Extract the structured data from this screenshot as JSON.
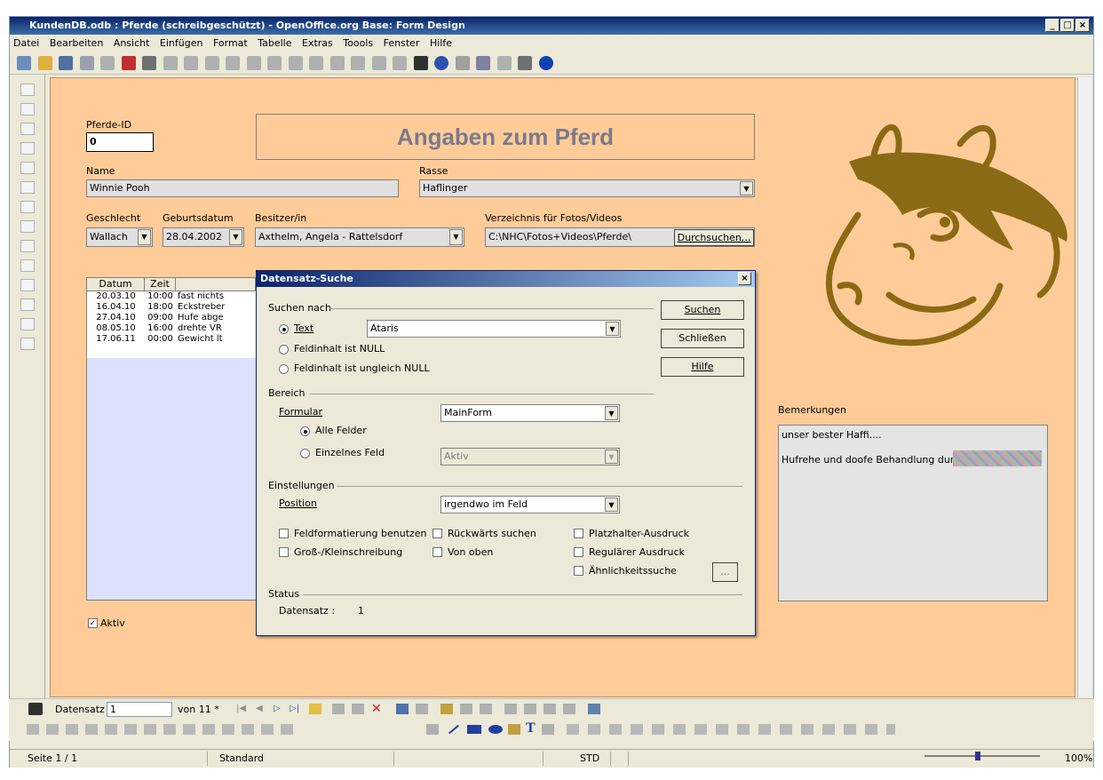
{
  "window": {
    "title": "KundenDB.odb : Pferde (schreibgeschützt) - OpenOffice.org Base: Form Design",
    "menu": [
      "Datei",
      "Bearbeiten",
      "Ansicht",
      "Einfügen",
      "Format",
      "Tabelle",
      "Extras",
      "Toools",
      "Fenster",
      "Hilfe"
    ]
  },
  "form": {
    "title": "Angaben zum Pferd",
    "pferde_id_label": "Pferde-ID",
    "pferde_id_value": "0",
    "name_label": "Name",
    "name_value": "Winnie Pooh",
    "rasse_label": "Rasse",
    "rasse_value": "Haflinger",
    "geschlecht_label": "Geschlecht",
    "geschlecht_value": "Wallach",
    "geburtsdatum_label": "Geburtsdatum",
    "geburtsdatum_value": "28.04.2002",
    "besitzer_label": "Besitzer/in",
    "besitzer_value": "Axthelm, Angela - Rattelsdorf",
    "verzeichnis_label": "Verzeichnis für Fotos/Videos",
    "verzeichnis_value": "C:\\NHC\\Fotos+Videos\\Pferde\\",
    "durchsuchen_label": "Durchsuchen...",
    "bemerkungen_label": "Bemerkungen",
    "bemerkungen_line1": "unser bester Haffi....",
    "bemerkungen_line2": "Hufrehe und doofe Behandlung durch",
    "aktiv_label": "Aktiv"
  },
  "grid": {
    "headers": [
      "Datum",
      "Zeit"
    ],
    "rows": [
      [
        "20.03.10",
        "10:00",
        "fast nichts"
      ],
      [
        "16.04.10",
        "18:00",
        "Eckstreber"
      ],
      [
        "27.04.10",
        "09:00",
        "Hufe abge"
      ],
      [
        "08.05.10",
        "16:00",
        "drehte VR"
      ],
      [
        "17.06.11",
        "00:00",
        "Gewicht lt"
      ]
    ]
  },
  "dialog": {
    "title": "Datensatz-Suche",
    "suchen_nach": "Suchen nach",
    "text_label": "Text",
    "text_value": "Ataris",
    "null_label": "Feldinhalt ist NULL",
    "not_null_label": "Feldinhalt ist ungleich NULL",
    "bereich": "Bereich",
    "formular_label": "Formular",
    "formular_value": "MainForm",
    "alle_felder": "Alle Felder",
    "einzelnes_feld": "Einzelnes Feld",
    "einzelnes_value": "Aktiv",
    "einstellungen": "Einstellungen",
    "position_label": "Position",
    "position_value": "irgendwo im Feld",
    "cb_feldformatierung": "Feldformatierung benutzen",
    "cb_rueckwaerts": "Rückwärts suchen",
    "cb_platzhalter": "Platzhalter-Ausdruck",
    "cb_gross": "Groß-/Kleinschreibung",
    "cb_von_oben": "Von oben",
    "cb_regulaer": "Regulärer Ausdruck",
    "cb_aehnlichkeit": "Ähnlichkeitssuche",
    "status": "Status",
    "datensatz_label": "Datensatz :",
    "datensatz_value": "1",
    "btn_suchen": "Suchen",
    "btn_schliessen": "Schließen",
    "btn_hilfe": "Hilfe",
    "btn_dots": "..."
  },
  "navbar": {
    "datensatz_label": "Datensatz",
    "datensatz_value": "1",
    "von_label": "von 11 *"
  },
  "statusbar": {
    "seite": "Seite 1 / 1",
    "standard": "Standard",
    "mode": "STD",
    "zoom": "100%"
  }
}
